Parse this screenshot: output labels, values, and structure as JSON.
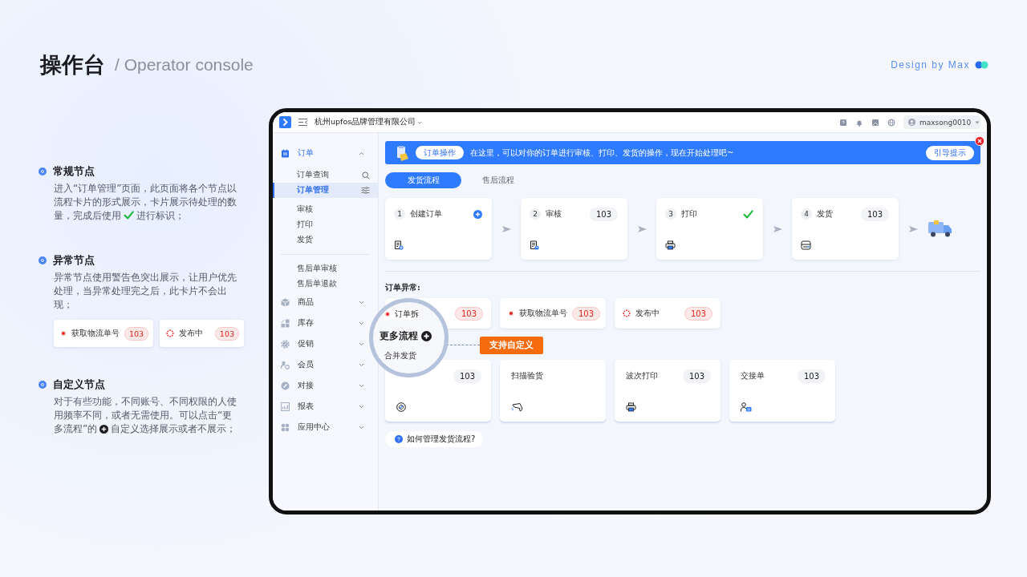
{
  "slide": {
    "title": "操作台",
    "subtitle": "/ Operator console",
    "credit": "Design by Max"
  },
  "notes": [
    {
      "title": "常规节点",
      "kind": "check",
      "text_before": "进入“订单管理”页面，此页面将各个节点以流程卡片的形式展示，卡片展示待处理的数量，完成后使用",
      "text_after": "进行标识；"
    },
    {
      "title": "异常节点",
      "kind": "examples",
      "text_before": "异常节点使用警告色突出展示，让用户优先处理，当异常处理完之后，此卡片不会出现；",
      "examples": [
        {
          "label": "获取物流单号",
          "count": "103",
          "kind": "dot"
        },
        {
          "label": "发布中",
          "count": "103",
          "kind": "spinner"
        }
      ]
    },
    {
      "title": "自定义节点",
      "kind": "plus",
      "text_before": "对于有些功能，不同账号、不同权限的人使用频率不同，或者无需使用。可以点击“更多流程”的",
      "text_after": "自定义选择展示或者不展示；"
    }
  ],
  "app": {
    "topbar": {
      "company": "杭州upfos品牌管理有限公司",
      "user": "maxsong0010"
    },
    "sidebar": {
      "items": [
        {
          "label": "订单",
          "expanded": true,
          "groups": [
            {
              "divider_before": false,
              "items": [
                {
                  "label": "订单查询",
                  "selected": false
                },
                {
                  "label": "订单管理",
                  "selected": true
                }
              ]
            },
            {
              "divider_before": false,
              "items": [
                {
                  "label": "审核",
                  "selected": false
                },
                {
                  "label": "打印",
                  "selected": false
                },
                {
                  "label": "发货",
                  "selected": false
                }
              ]
            },
            {
              "divider_before": true,
              "items": [
                {
                  "label": "售后单审核",
                  "selected": false
                },
                {
                  "label": "售后单退款",
                  "selected": false
                }
              ]
            }
          ]
        },
        {
          "label": "商品",
          "expanded": false
        },
        {
          "label": "库存",
          "expanded": false
        },
        {
          "label": "促销",
          "expanded": false
        },
        {
          "label": "会员",
          "expanded": false
        },
        {
          "label": "对接",
          "expanded": false
        },
        {
          "label": "报表",
          "expanded": false
        },
        {
          "label": "应用中心",
          "expanded": false
        }
      ]
    },
    "banner": {
      "tag": "订单操作",
      "text": "在这里，可以对你的订单进行审核、打印、发货的操作，现在开始处理吧~",
      "button": "引导提示"
    },
    "tabs": [
      {
        "label": "发货流程",
        "selected": true
      },
      {
        "label": "售后流程",
        "selected": false
      }
    ],
    "steps": [
      {
        "number": "1",
        "title": "创建订单",
        "kind": "add"
      },
      {
        "number": "2",
        "title": "审核",
        "kind": "count",
        "count": "103"
      },
      {
        "number": "3",
        "title": "打印",
        "kind": "done"
      },
      {
        "number": "4",
        "title": "发货",
        "kind": "count",
        "count": "103"
      }
    ],
    "exceptions": {
      "label": "订单异常:",
      "items": [
        {
          "label": "订单拆",
          "count": "103",
          "kind": "dot"
        },
        {
          "label": "获取物流单号",
          "count": "103",
          "kind": "dot"
        },
        {
          "label": "发布中",
          "count": "103",
          "kind": "spinner"
        }
      ]
    },
    "more": {
      "tag": "支持自定义"
    },
    "magnifier": {
      "label": "更多流程"
    },
    "flows": [
      {
        "title": "合并发货",
        "count": "103"
      },
      {
        "title": "扫描验货"
      },
      {
        "title": "波次打印",
        "count": "103"
      },
      {
        "title": "交接单",
        "count": "103"
      }
    ],
    "help": "如何管理发货流程?"
  }
}
